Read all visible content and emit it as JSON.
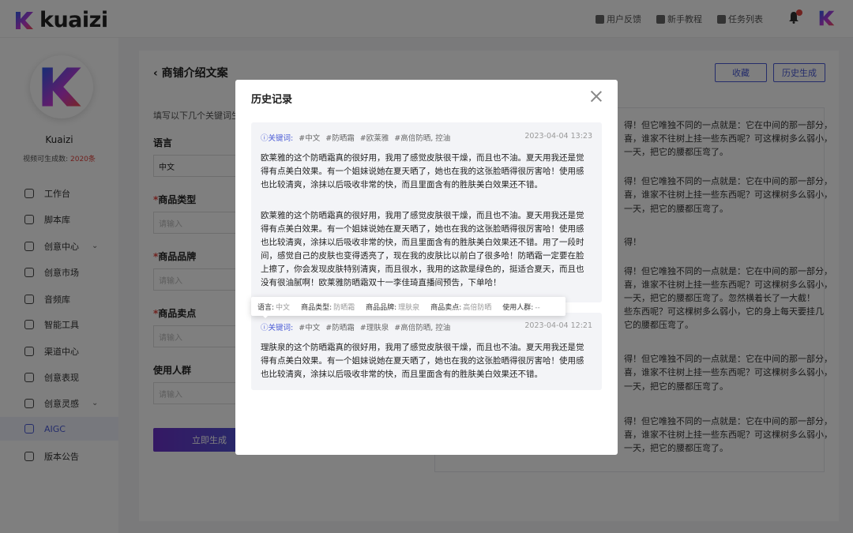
{
  "app": {
    "logo_text": "kuaizi",
    "brand_color": "#4a5bd6",
    "top_links": [
      "用户反馈",
      "新手教程",
      "任务列表"
    ]
  },
  "sidebar": {
    "user_name": "Kuaizi",
    "quota_label": "视频可生成数: ",
    "quota_value": "2020条",
    "items": [
      {
        "label": "工作台",
        "icon": "dashboard-icon"
      },
      {
        "label": "脚本库",
        "icon": "script-icon"
      },
      {
        "label": "创意中心",
        "icon": "creative-icon",
        "expandable": true
      },
      {
        "label": "创意市场",
        "icon": "market-icon"
      },
      {
        "label": "音频库",
        "icon": "audio-icon"
      },
      {
        "label": "智能工具",
        "icon": "tool-icon"
      },
      {
        "label": "渠道中心",
        "icon": "channel-icon"
      },
      {
        "label": "创意表现",
        "icon": "chart-icon"
      },
      {
        "label": "创意灵感",
        "icon": "bulb-icon",
        "expandable": true
      },
      {
        "label": "AIGC",
        "icon": "aigc-icon",
        "active": true
      },
      {
        "label": "版本公告",
        "icon": "bell-icon"
      }
    ]
  },
  "page": {
    "title": "商铺介绍文案",
    "collect_button": "收藏",
    "history_button": "历史生成",
    "form_hint": "填写以下几个关键词生",
    "language_label": "语言",
    "language_value": "中文",
    "product_type_label": "商品类型",
    "product_brand_label": "商品品牌",
    "product_selling_label": "商品卖点",
    "audience_label": "使用人群",
    "input_placeholder": "请输入",
    "generate_button": "立即生成",
    "result_lines": [
      "得！但它唯独不同的一点就是：它在中间的那一部分，",
      "喜，谁家不往树上挂一些东西呢？可这棵树多么弱小，",
      "一天，把它的腰都压弯了。",
      "得！但它唯独不同的一点就是：它在中间的那一部分，",
      "喜，谁家不往树上挂一些东西呢？可这棵树多么弱小，",
      "一天，把它的腰都压弯了。",
      "得！",
      "得！但它唯独不同的一点就是：它在中间的那一部分，",
      "喜，谁家不往树上挂一些东西呢？可这棵树多么弱小，",
      "一天，把它的腰都压弯了。忽然横着长了一大截！",
      "些东西呢？可这棵树多么弱小，它的身上每天要挂几",
      "它的腰都压弯了。",
      "得！但它唯独不同的一点就是：它在中间的那一部分，",
      "喜，谁家不往树上挂一些东西呢？可这棵树多么弱小，",
      "一天，把它的腰都压弯了。",
      "得！但它唯独不同的一点就是：它在中间的那一部分，",
      "喜，谁家不往树上挂一些东西呢？可这棵树多么弱小，",
      "一天，把它的腰都压弯了。"
    ]
  },
  "modal": {
    "title": "历史记录",
    "keyword_label": "关键词:",
    "records": [
      {
        "tags": [
          "#中文",
          "#防晒霜",
          "#欧莱雅",
          "#高倍防晒, 控油"
        ],
        "time": "2023-04-04 13:23",
        "paragraphs": [
          [
            "欧莱雅的这个防晒霜真的很好用，我用了感觉皮肤很干燥，而且也不油。夏天用我还是觉",
            "得有点美白效果。有一个姐妹说她在夏天晒了，她也在我的这张脸晒得很厉害哈！使用感",
            "也比较清爽，涂抹以后吸收非常的快，而且里面含有的胜肤美白效果还不错。"
          ],
          [
            "欧莱雅的这个防晒霜真的很好用，我用了感觉皮肤很干燥，而且也不油。夏天用我还是觉",
            "得有点美白效果。有一个姐妹说她在夏天晒了，她也在我的这张脸晒得很厉害哈！使用感",
            "也比较清爽，涂抹以后吸收非常的快，而且里面含有的胜肤美白效果还不错。用了一段时",
            "间，感觉自己的皮肤也变得透亮了，现在我的皮肤比以前白了很多哈！防晒霜一定要在脸",
            "上擦了，你会发现皮肤特别清爽，而且很水，我用的这款是绿色的，挺适合夏天，而且也",
            "没有很油腻啊！欧莱雅防晒霜双十一李佳琦直播间预告，下单哈！"
          ]
        ]
      },
      {
        "tags": [
          "#中文",
          "#防晒霜",
          "#理肤泉",
          "#高倍防晒, 控油"
        ],
        "time": "2023-04-04 12:21",
        "paragraphs": [
          [
            "理肤泉的这个防晒霜真的很好用，我用了感觉皮肤很干燥，而且也不油。夏天用我还是觉",
            "得有点美白效果。有一个姐妹说她在夏天晒了，她也在我的这张脸晒得很厉害哈！使用感",
            "也比较清爽，涂抹以后吸收非常的快，而且里面含有的胜肤美白效果还不错。"
          ]
        ]
      }
    ],
    "tooltip": {
      "language_label": "语言:",
      "language_value": "中文",
      "type_label": "商品类型:",
      "type_value": "防晒霜",
      "brand_label": "商品品牌:",
      "brand_value": "理肤泉",
      "selling_label": "商品卖点:",
      "selling_value": "高倍防晒",
      "audience_label": "使用人群:",
      "audience_value": "--"
    }
  }
}
